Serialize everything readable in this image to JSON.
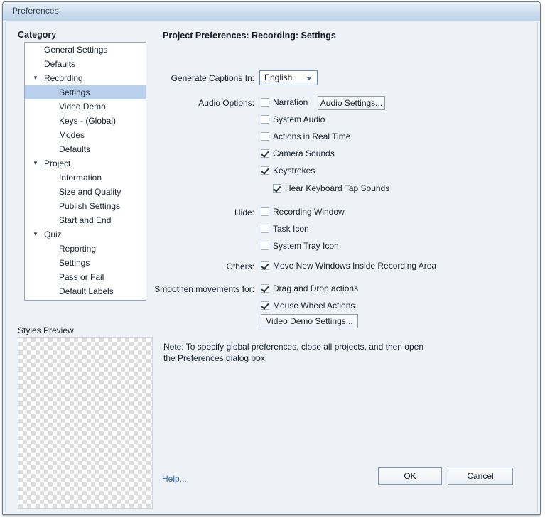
{
  "window": {
    "title": "Preferences"
  },
  "sidebar": {
    "heading": "Category",
    "items": [
      {
        "label": "General Settings",
        "level": 1,
        "twisty": "",
        "selected": false
      },
      {
        "label": "Defaults",
        "level": 1,
        "twisty": "",
        "selected": false
      },
      {
        "label": "Recording",
        "level": 1,
        "twisty": "▼",
        "selected": false
      },
      {
        "label": "Settings",
        "level": 2,
        "twisty": "",
        "selected": true
      },
      {
        "label": "Video Demo",
        "level": 2,
        "twisty": "",
        "selected": false
      },
      {
        "label": "Keys - (Global)",
        "level": 2,
        "twisty": "",
        "selected": false
      },
      {
        "label": "Modes",
        "level": 2,
        "twisty": "",
        "selected": false
      },
      {
        "label": "Defaults",
        "level": 2,
        "twisty": "",
        "selected": false
      },
      {
        "label": "Project",
        "level": 1,
        "twisty": "▼",
        "selected": false
      },
      {
        "label": "Information",
        "level": 2,
        "twisty": "",
        "selected": false
      },
      {
        "label": "Size and Quality",
        "level": 2,
        "twisty": "",
        "selected": false
      },
      {
        "label": "Publish Settings",
        "level": 2,
        "twisty": "",
        "selected": false
      },
      {
        "label": "Start and End",
        "level": 2,
        "twisty": "",
        "selected": false
      },
      {
        "label": "Quiz",
        "level": 1,
        "twisty": "▼",
        "selected": false
      },
      {
        "label": "Reporting",
        "level": 2,
        "twisty": "",
        "selected": false
      },
      {
        "label": "Settings",
        "level": 2,
        "twisty": "",
        "selected": false
      },
      {
        "label": "Pass or Fail",
        "level": 2,
        "twisty": "",
        "selected": false
      },
      {
        "label": "Default Labels",
        "level": 2,
        "twisty": "",
        "selected": false
      }
    ],
    "styles_preview_label": "Styles Preview"
  },
  "main": {
    "title": "Project Preferences: Recording: Settings",
    "captions": {
      "label": "Generate Captions In:",
      "value": "English",
      "options": [
        "English"
      ]
    },
    "audio_options": {
      "label": "Audio Options:",
      "button_label": "Audio Settings...",
      "items": [
        {
          "label": "Narration",
          "checked": false
        },
        {
          "label": "System Audio",
          "checked": false
        },
        {
          "label": "Actions in Real Time",
          "checked": false
        },
        {
          "label": "Camera Sounds",
          "checked": true
        },
        {
          "label": "Keystrokes",
          "checked": true
        },
        {
          "label": "Hear Keyboard Tap Sounds",
          "checked": true,
          "indented": true
        }
      ]
    },
    "hide": {
      "label": "Hide:",
      "items": [
        {
          "label": "Recording Window",
          "checked": false
        },
        {
          "label": "Task Icon",
          "checked": false
        },
        {
          "label": "System Tray Icon",
          "checked": false
        }
      ]
    },
    "others": {
      "label": "Others:",
      "items": [
        {
          "label": "Move New Windows Inside Recording Area",
          "checked": true
        }
      ]
    },
    "smoothen": {
      "label": "Smoothen movements for:",
      "items": [
        {
          "label": "Drag and Drop actions",
          "checked": true
        },
        {
          "label": "Mouse Wheel Actions",
          "checked": true
        }
      ],
      "button_label": "Video Demo Settings..."
    },
    "note": "Note: To specify global preferences, close all projects, and then open the Preferences dialog box."
  },
  "footer": {
    "help_label": "Help...",
    "ok_label": "OK",
    "cancel_label": "Cancel"
  },
  "colors": {
    "selection": "#b9d0ec",
    "link": "#2a6bb5",
    "dialog_bg": "#eef2f7"
  }
}
